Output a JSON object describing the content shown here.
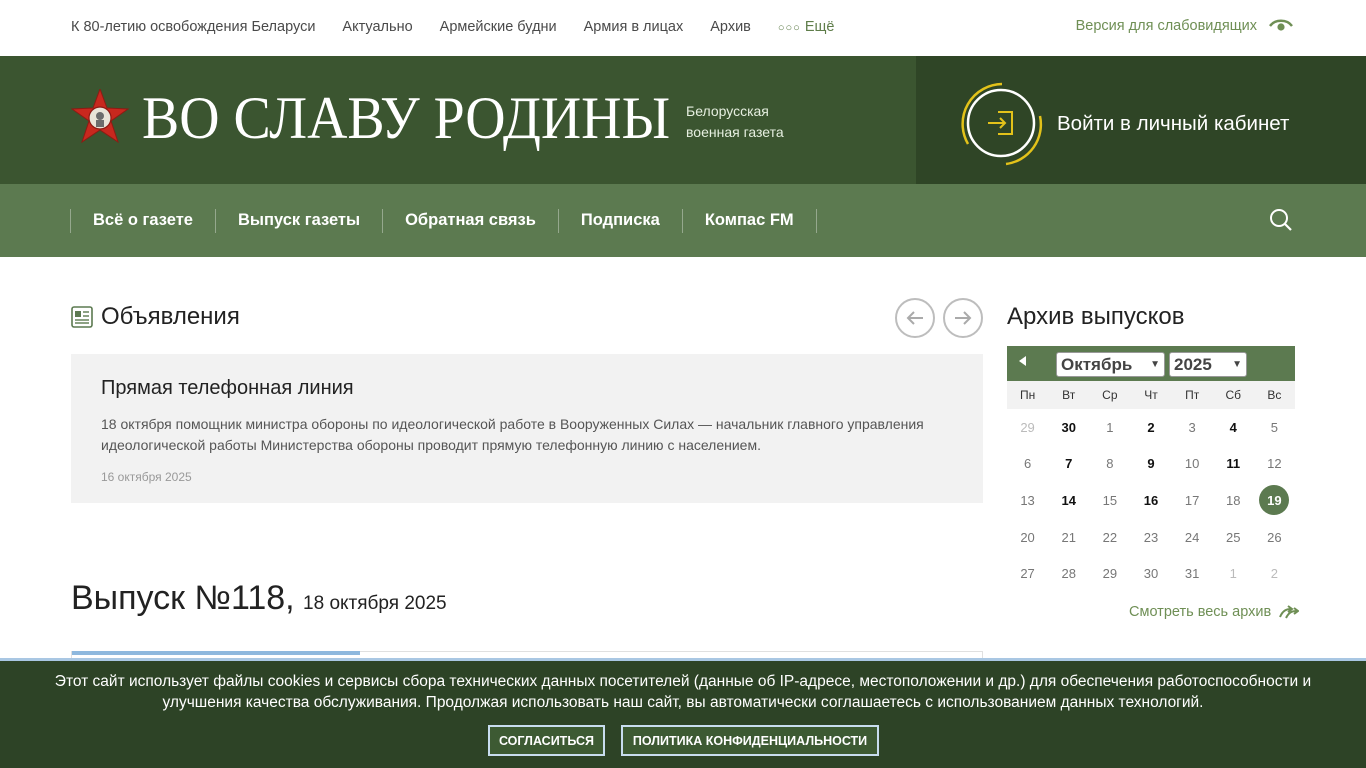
{
  "topbar": {
    "links": [
      "К 80-летию освобождения Беларуси",
      "Актуально",
      "Армейские будни",
      "Армия в лицах",
      "Архив"
    ],
    "more": "Ещё",
    "accessibility": "Версия для слабовидящих"
  },
  "header": {
    "logo_text": "ВО СЛАВУ РОДИНЫ",
    "subtitle_line1": "Белорусская",
    "subtitle_line2": "военная газета",
    "login": "Войти в личный кабинет"
  },
  "mainnav": {
    "items": [
      "Всё о газете",
      "Выпуск газеты",
      "Обратная связь",
      "Подписка",
      "Компас FM"
    ]
  },
  "announcements": {
    "title": "Объявления",
    "card": {
      "title": "Прямая телефонная линия",
      "text": "18 октября помощник министра обороны по идеологической работе в Вооруженных Силах — начальник главного управления идеологической работы Министерства обороны проводит прямую телефонную линию с населением.",
      "date": "16 октября 2025"
    }
  },
  "issue": {
    "number": "Выпуск №118,",
    "date": "18 октября 2025"
  },
  "archive": {
    "title": "Архив выпусков",
    "month": "Октябрь",
    "year": "2025",
    "weekdays": [
      "Пн",
      "Вт",
      "Ср",
      "Чт",
      "Пт",
      "Сб",
      "Вс"
    ],
    "days": [
      {
        "d": "29",
        "t": "other"
      },
      {
        "d": "30",
        "t": "has"
      },
      {
        "d": "1",
        "t": "n"
      },
      {
        "d": "2",
        "t": "has"
      },
      {
        "d": "3",
        "t": "n"
      },
      {
        "d": "4",
        "t": "has"
      },
      {
        "d": "5",
        "t": "n"
      },
      {
        "d": "6",
        "t": "n"
      },
      {
        "d": "7",
        "t": "has"
      },
      {
        "d": "8",
        "t": "n"
      },
      {
        "d": "9",
        "t": "has"
      },
      {
        "d": "10",
        "t": "n"
      },
      {
        "d": "11",
        "t": "has"
      },
      {
        "d": "12",
        "t": "n"
      },
      {
        "d": "13",
        "t": "n"
      },
      {
        "d": "14",
        "t": "has"
      },
      {
        "d": "15",
        "t": "n"
      },
      {
        "d": "16",
        "t": "has"
      },
      {
        "d": "17",
        "t": "n"
      },
      {
        "d": "18",
        "t": "n"
      },
      {
        "d": "19",
        "t": "today"
      },
      {
        "d": "20",
        "t": "n"
      },
      {
        "d": "21",
        "t": "n"
      },
      {
        "d": "22",
        "t": "n"
      },
      {
        "d": "23",
        "t": "n"
      },
      {
        "d": "24",
        "t": "n"
      },
      {
        "d": "25",
        "t": "n"
      },
      {
        "d": "26",
        "t": "n"
      },
      {
        "d": "27",
        "t": "n"
      },
      {
        "d": "28",
        "t": "n"
      },
      {
        "d": "29",
        "t": "n"
      },
      {
        "d": "30",
        "t": "n"
      },
      {
        "d": "31",
        "t": "n"
      },
      {
        "d": "1",
        "t": "other"
      },
      {
        "d": "2",
        "t": "other"
      }
    ],
    "view_all": "Смотреть весь архив"
  },
  "cookie": {
    "text": "Этот сайт использует файлы cookies и сервисы сбора технических данных посетителей (данные об IP-адресе, местоположении и др.) для обеспечения работоспособности и улучшения качества обслуживания. Продолжая использовать наш сайт, вы автоматически соглашаетесь с использованием данных технологий.",
    "accept": "СОГЛАСИТЬСЯ",
    "policy": "ПОЛИТИКА КОНФИДЕНЦИАЛЬНОСТИ"
  },
  "colors": {
    "header_bg": "#3b5530",
    "nav_bg": "#5c7a50",
    "accent_green": "#6f8f55",
    "cookie_bg": "#2d4326",
    "login_ring": "#e3c21a"
  }
}
